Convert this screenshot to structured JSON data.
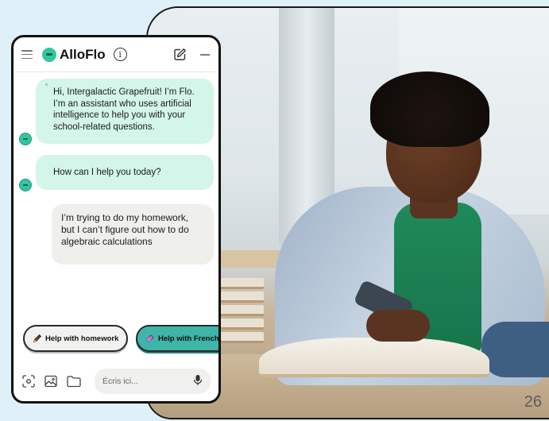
{
  "slide": {
    "number": "26"
  },
  "chat": {
    "brand": "AlloFlo",
    "messages": [
      {
        "role": "bot",
        "text": "Hi, Intergalactic Grapefruit! I’m Flo. I’m an assistant who uses artificial intelligence to help you with your school-related questions."
      },
      {
        "role": "bot",
        "text": "How can I help you today?"
      },
      {
        "role": "user",
        "text": "I’m trying to do my homework, but I can’t figure out how to do algebraic calculations"
      }
    ],
    "suggestions": [
      {
        "label": "Help with homework",
        "icon": "pencil-icon"
      },
      {
        "label": "Help with French",
        "icon": "eraser-icon"
      }
    ],
    "input": {
      "placeholder": "Écris ici..."
    },
    "colors": {
      "accent": "#2fc7a0",
      "bot_bubble": "#d3f5ea",
      "user_bubble": "#efefec",
      "french_chip": "#3fb4a8"
    }
  }
}
